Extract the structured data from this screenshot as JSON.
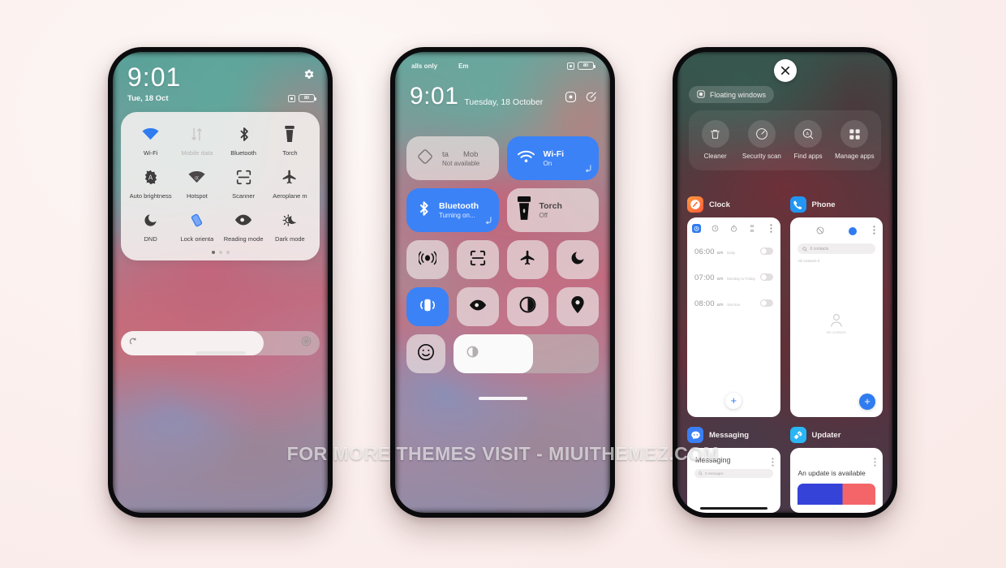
{
  "watermark": "FOR MORE THEMES VISIT - MIUITHEMEZ.COM",
  "phone1": {
    "status": {
      "time": "9:01",
      "date": "Tue, 18 Oct",
      "battery_label": "80"
    },
    "toggles": [
      {
        "label": "Wi-Fi",
        "icon": "wifi-icon",
        "state": "on",
        "has_arrow": true
      },
      {
        "label": "Mobile data",
        "icon": "mobile-data-icon",
        "state": "disabled",
        "has_arrow": false
      },
      {
        "label": "Bluetooth",
        "icon": "bluetooth-icon",
        "state": "off",
        "has_arrow": true
      },
      {
        "label": "Torch",
        "icon": "torch-icon",
        "state": "off",
        "has_arrow": false
      },
      {
        "label": "Auto brightness",
        "icon": "auto-brightness-icon",
        "state": "off",
        "has_arrow": false
      },
      {
        "label": "Hotspot",
        "icon": "hotspot-icon",
        "state": "off",
        "has_arrow": false
      },
      {
        "label": "Scanner",
        "icon": "scanner-icon",
        "state": "off",
        "has_arrow": false
      },
      {
        "label": "Aeroplane m",
        "icon": "aeroplane-mode-icon",
        "state": "off",
        "has_arrow": false
      },
      {
        "label": "DND",
        "icon": "dnd-moon-icon",
        "state": "off",
        "has_arrow": false
      },
      {
        "label": "Lock orienta",
        "icon": "lock-orientation-icon",
        "state": "on",
        "has_arrow": false
      },
      {
        "label": "Reading mode",
        "icon": "reading-mode-eye-icon",
        "state": "off",
        "has_arrow": false
      },
      {
        "label": "Dark mode",
        "icon": "dark-mode-icon",
        "state": "off",
        "has_arrow": false
      }
    ],
    "page_dots": {
      "count": 3,
      "active": 1
    },
    "brightness": {
      "percent": 72
    }
  },
  "phone2": {
    "status": {
      "carrier_1": "alls only",
      "carrier_2": "Em",
      "battery_label": "80"
    },
    "header": {
      "time": "9:01",
      "date": "Tuesday, 18 October"
    },
    "header_icons": [
      "user-profile-icon",
      "edit-toggles-icon"
    ],
    "big_tiles": [
      {
        "name": "mobile-data-tile",
        "title_a": "ta",
        "title_b": "Mob",
        "subtitle": "Not available",
        "icon": "sim-card-icon",
        "state": "off",
        "has_arrow": false
      },
      {
        "name": "wifi-tile",
        "title": "Wi-Fi",
        "subtitle": "On",
        "icon": "wifi-icon",
        "state": "on",
        "has_arrow": true
      },
      {
        "name": "bluetooth-tile",
        "title": "Bluetooth",
        "subtitle": "Turning on...",
        "icon": "bluetooth-icon",
        "state": "on",
        "has_arrow": true
      },
      {
        "name": "torch-tile",
        "title": "Torch",
        "subtitle": "Off",
        "icon": "torch-icon",
        "state": "off",
        "has_arrow": false
      }
    ],
    "small_tiles": [
      {
        "name": "sound-tile",
        "icon": "sound-waves-icon",
        "state": "off"
      },
      {
        "name": "scanner-tile",
        "icon": "scanner-icon",
        "state": "off"
      },
      {
        "name": "aeroplane-tile",
        "icon": "aeroplane-mode-icon",
        "state": "off"
      },
      {
        "name": "dnd-tile",
        "icon": "dnd-moon-icon",
        "state": "off"
      },
      {
        "name": "lock-orientation-tile",
        "icon": "lock-orientation-icon",
        "state": "on"
      },
      {
        "name": "reading-mode-tile",
        "icon": "reading-mode-eye-icon",
        "state": "off"
      },
      {
        "name": "dark-mode-tile",
        "icon": "contrast-circle-icon",
        "state": "off"
      },
      {
        "name": "location-tile",
        "icon": "location-pin-icon",
        "state": "off"
      },
      {
        "name": "smiley-tile",
        "icon": "smiley-face-icon",
        "state": "off"
      }
    ],
    "brightness": {
      "percent": 55
    }
  },
  "phone3": {
    "floating_windows_chip": "Floating windows",
    "shortcuts": [
      {
        "label": "Cleaner",
        "icon": "trash-can-icon"
      },
      {
        "label": "Security scan",
        "icon": "speed-gauge-icon"
      },
      {
        "label": "Find apps",
        "icon": "search-apps-icon"
      },
      {
        "label": "Manage apps",
        "icon": "grid-apps-icon"
      }
    ],
    "recents": [
      {
        "app": "Clock",
        "icon": "clock-app-icon",
        "alarms": [
          {
            "time": "06:00",
            "meridiem": "am",
            "repeat": "Daily"
          },
          {
            "time": "07:00",
            "meridiem": "am",
            "repeat": "Monday to Friday"
          },
          {
            "time": "08:00",
            "meridiem": "am",
            "repeat": "Sat-Sun"
          }
        ],
        "fab": "+"
      },
      {
        "app": "Phone",
        "icon": "phone-app-icon",
        "search_placeholder": "0 contacts",
        "all_contacts_label": "All contacts  0",
        "empty_label": "No contacts",
        "fab": "+"
      },
      {
        "app": "Messaging",
        "icon": "messaging-app-icon",
        "title": "Messaging",
        "search_placeholder": "0 messages"
      },
      {
        "app": "Updater",
        "icon": "updater-app-icon",
        "title": "An update is available"
      }
    ],
    "close_button": "close-icon"
  },
  "colors": {
    "accent_blue": "#3b82f6",
    "page_bg": "#fbeeec",
    "panel_bg": "#f6f1f0",
    "fab_blue": "#2f7bf0"
  }
}
